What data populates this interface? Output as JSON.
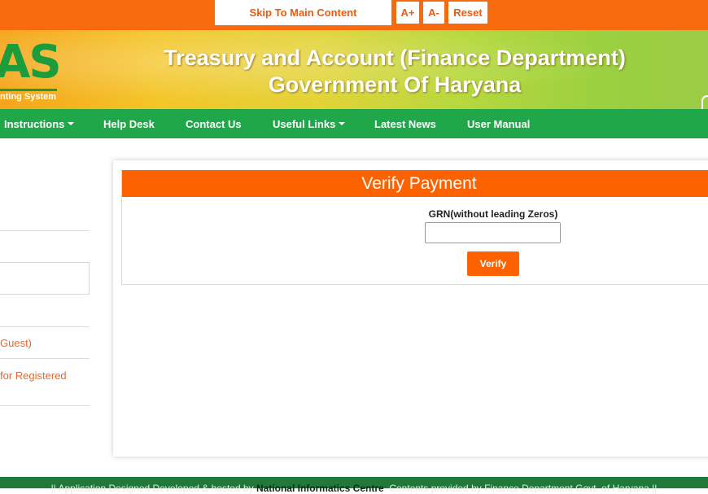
{
  "accessibility": {
    "skip_label": "Skip To Main Content",
    "increase_font": "A+",
    "decrease_font": "A-",
    "reset": "Reset"
  },
  "header": {
    "logo_text": "AS",
    "logo_subtext": "nting System",
    "title_line1": "Treasury and Account (Finance Department)",
    "title_line2": "Government Of Haryana"
  },
  "nav": {
    "items": [
      {
        "label": "Instructions",
        "dropdown": true
      },
      {
        "label": "Help Desk",
        "dropdown": false
      },
      {
        "label": "Contact Us",
        "dropdown": false
      },
      {
        "label": "Useful Links",
        "dropdown": true
      },
      {
        "label": "Latest News",
        "dropdown": false
      },
      {
        "label": "User Manual",
        "dropdown": false
      }
    ]
  },
  "sidebar": {
    "link_guest": "Guest)",
    "link_registered": "for Registered"
  },
  "verify": {
    "heading": "Verify Payment",
    "grn_label": "GRN(without leading Zeros)",
    "grn_value": "",
    "button": "Verify"
  },
  "footer": {
    "prefix": "|| Application Designed Developed & hosted by ",
    "nic": "National Informatics Centre",
    "suffix": ", Contents provided by Finance Department Govt. of Haryana ||"
  },
  "colors": {
    "accent_orange": "#fc6200",
    "nav_green": "#20a74a",
    "footer_green": "#1f7a3a"
  }
}
